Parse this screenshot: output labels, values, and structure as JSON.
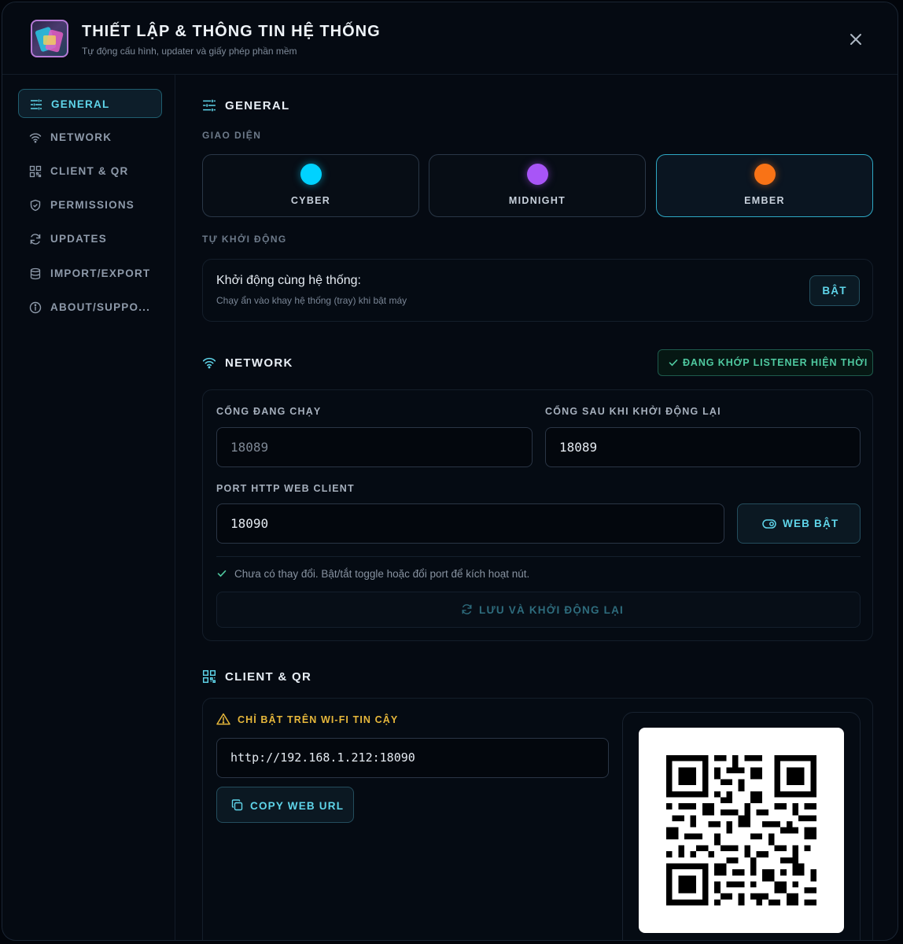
{
  "header": {
    "title": "THIẾT LẬP & THÔNG TIN HỆ THỐNG",
    "subtitle": "Tự động cấu hình, updater và giấy phép phần mềm"
  },
  "sidebar": {
    "items": [
      {
        "label": "GENERAL",
        "icon": "sliders-icon",
        "active": true
      },
      {
        "label": "NETWORK",
        "icon": "wifi-icon"
      },
      {
        "label": "CLIENT & QR",
        "icon": "qr-icon"
      },
      {
        "label": "PERMISSIONS",
        "icon": "shield-icon"
      },
      {
        "label": "UPDATES",
        "icon": "refresh-icon"
      },
      {
        "label": "IMPORT/EXPORT",
        "icon": "database-icon"
      },
      {
        "label": "ABOUT/SUPPO...",
        "icon": "info-icon"
      }
    ]
  },
  "general": {
    "heading": "GENERAL",
    "theme_label": "GIAO DIỆN",
    "themes": [
      {
        "name": "CYBER",
        "color": "#00d2ff"
      },
      {
        "name": "MIDNIGHT",
        "color": "#a855f7"
      },
      {
        "name": "EMBER",
        "color": "#f97316",
        "selected": true
      }
    ],
    "autostart_label": "TỰ KHỞI ĐỘNG",
    "autostart_title": "Khởi động cùng hệ thống:",
    "autostart_desc": "Chạy ẩn vào khay hệ thống (tray) khi bật máy",
    "autostart_button": "BẬT"
  },
  "network": {
    "heading": "NETWORK",
    "badge": "ĐANG KHỚP LISTENER HIỆN THỜI",
    "current_port_label": "CỔNG ĐANG CHẠY",
    "current_port_value": "18089",
    "restart_port_label": "CỔNG SAU KHI KHỞI ĐỘNG LẠI",
    "restart_port_value": "18089",
    "web_port_label": "PORT HTTP WEB CLIENT",
    "web_port_value": "18090",
    "web_toggle_label": "WEB BẬT",
    "note": "Chưa có thay đổi. Bật/tắt toggle hoặc đổi port để kích hoạt nút.",
    "save_button": "LƯU VÀ KHỞI ĐỘNG LẠI"
  },
  "client": {
    "heading": "CLIENT & QR",
    "warning": "CHỈ BẬT TRÊN WI-FI TIN CẬY",
    "url": "http://192.168.1.212:18090",
    "copy_button": "COPY WEB URL"
  },
  "colors": {
    "accent": "#5fd5ea",
    "success": "#4fc9a0",
    "warning": "#e6b73b"
  }
}
